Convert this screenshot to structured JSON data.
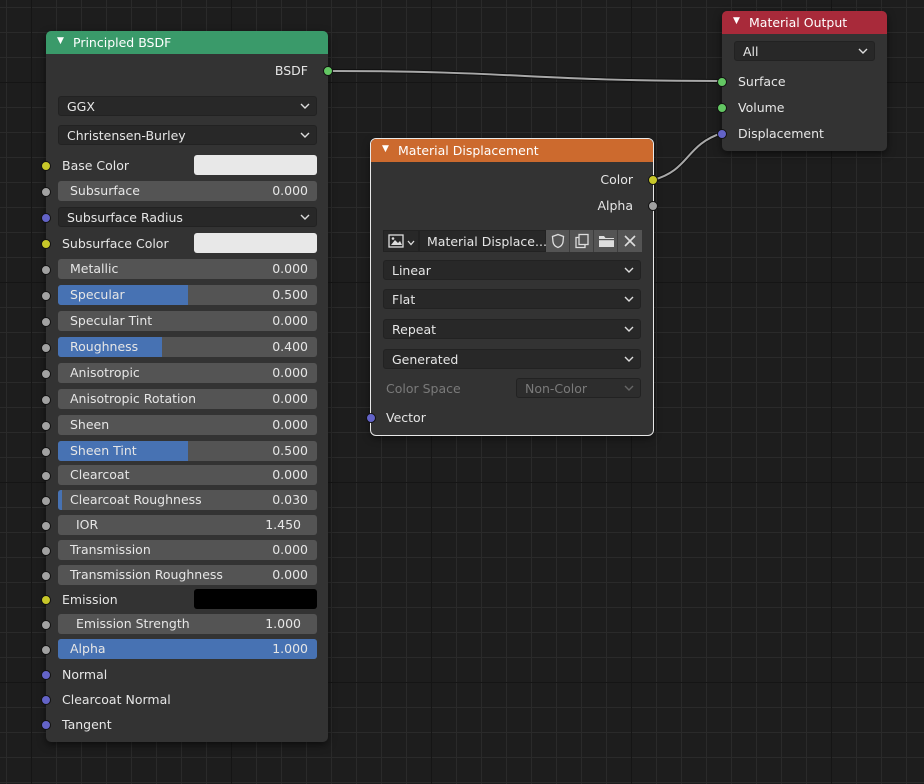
{
  "principled": {
    "title": "Principled BSDF",
    "output_label": "BSDF",
    "distribution": "GGX",
    "subsurface_method": "Christensen-Burley",
    "inputs": [
      {
        "label": "Base Color",
        "socket": "yellow",
        "kind": "color",
        "color": "#e8e8e8"
      },
      {
        "label": "Subsurface",
        "socket": "grey",
        "kind": "slider",
        "value": "0.000",
        "fraction": 0
      },
      {
        "label": "Subsurface Radius",
        "socket": "blue",
        "kind": "dropdown"
      },
      {
        "label": "Subsurface Color",
        "socket": "yellow",
        "kind": "color",
        "color": "#e8e8e8"
      },
      {
        "label": "Metallic",
        "socket": "grey",
        "kind": "slider",
        "value": "0.000",
        "fraction": 0
      },
      {
        "label": "Specular",
        "socket": "grey",
        "kind": "slider",
        "value": "0.500",
        "fraction": 0.5
      },
      {
        "label": "Specular Tint",
        "socket": "grey",
        "kind": "slider",
        "value": "0.000",
        "fraction": 0
      },
      {
        "label": "Roughness",
        "socket": "grey",
        "kind": "slider",
        "value": "0.400",
        "fraction": 0.4
      },
      {
        "label": "Anisotropic",
        "socket": "grey",
        "kind": "slider",
        "value": "0.000",
        "fraction": 0
      },
      {
        "label": "Anisotropic Rotation",
        "socket": "grey",
        "kind": "slider",
        "value": "0.000",
        "fraction": 0
      },
      {
        "label": "Sheen",
        "socket": "grey",
        "kind": "slider",
        "value": "0.000",
        "fraction": 0
      },
      {
        "label": "Sheen Tint",
        "socket": "grey",
        "kind": "slider",
        "value": "0.500",
        "fraction": 0.5
      },
      {
        "label": "Clearcoat",
        "socket": "grey",
        "kind": "slider",
        "value": "0.000",
        "fraction": 0
      },
      {
        "label": "Clearcoat Roughness",
        "socket": "grey",
        "kind": "slider",
        "value": "0.030",
        "fraction": 0.03
      },
      {
        "label": "IOR",
        "socket": "grey",
        "kind": "field",
        "value": "1.450"
      },
      {
        "label": "Transmission",
        "socket": "grey",
        "kind": "slider",
        "value": "0.000",
        "fraction": 0
      },
      {
        "label": "Transmission Roughness",
        "socket": "grey",
        "kind": "slider",
        "value": "0.000",
        "fraction": 0
      },
      {
        "label": "Emission",
        "socket": "yellow",
        "kind": "color",
        "color": "#000000"
      },
      {
        "label": "Emission Strength",
        "socket": "grey",
        "kind": "field",
        "value": "1.000"
      },
      {
        "label": "Alpha",
        "socket": "grey",
        "kind": "slider",
        "value": "1.000",
        "fraction": 1
      },
      {
        "label": "Normal",
        "socket": "blue",
        "kind": "socket"
      },
      {
        "label": "Clearcoat Normal",
        "socket": "blue",
        "kind": "socket"
      },
      {
        "label": "Tangent",
        "socket": "blue",
        "kind": "socket"
      }
    ]
  },
  "image_node": {
    "title": "Material Displacement",
    "outputs": [
      {
        "label": "Color",
        "socket": "yellow"
      },
      {
        "label": "Alpha",
        "socket": "grey"
      }
    ],
    "image_name": "Material Displace...",
    "interpolation": "Linear",
    "projection": "Flat",
    "extension": "Repeat",
    "source": "Generated",
    "color_space_label": "Color Space",
    "color_space_value": "Non-Color",
    "vector_label": "Vector"
  },
  "output_node": {
    "title": "Material Output",
    "target": "All",
    "inputs": [
      {
        "label": "Surface",
        "socket": "green"
      },
      {
        "label": "Volume",
        "socket": "green"
      },
      {
        "label": "Displacement",
        "socket": "blue"
      }
    ]
  },
  "colors": {
    "shader_header": "#3a9a6a",
    "texture_header": "#cc6a2e",
    "output_header": "#a82a3a",
    "slider_fill": "#4772b3"
  },
  "icons": [
    "image-icon",
    "chevron-down-icon",
    "fake-user-shield-icon",
    "duplicate-icon",
    "folder-icon",
    "close-icon"
  ]
}
